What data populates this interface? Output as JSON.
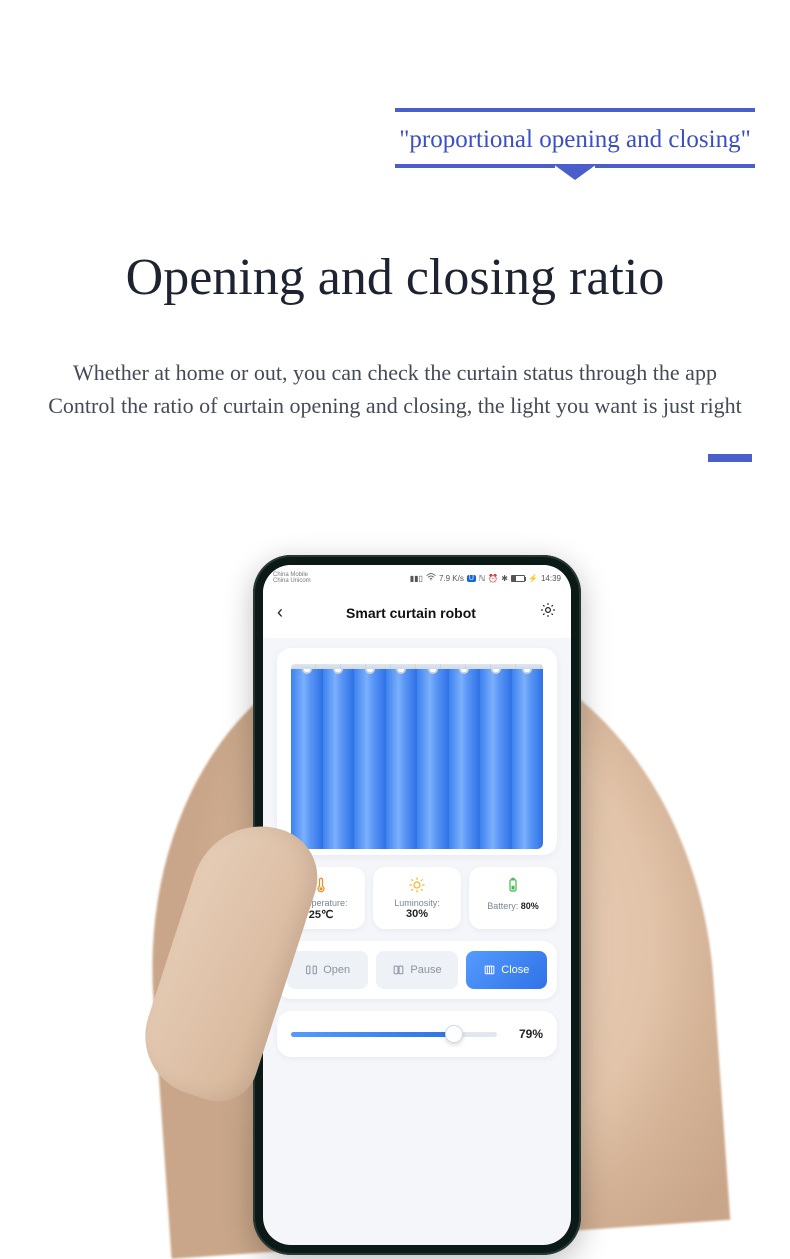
{
  "marketing": {
    "ribbon": "\"proportional opening and closing\"",
    "title": "Opening and closing ratio",
    "subtitle_line1": "Whether at home or out, you can check the curtain status through the app",
    "subtitle_line2": "Control the ratio of curtain opening and closing, the light you want is just right"
  },
  "statusbar": {
    "carrier1": "China Mobile",
    "carrier2": "China Unicom",
    "net_speed": "7.9 K/s",
    "battery_text": "33",
    "time": "14:39"
  },
  "app": {
    "title": "Smart curtain robot"
  },
  "stats": {
    "temperature": {
      "label": "Temperature:",
      "value": "25℃"
    },
    "luminosity": {
      "label": "Luminosity:",
      "value": "30%"
    },
    "battery": {
      "label": "Battery:",
      "value": "80%"
    }
  },
  "controls": {
    "open": "Open",
    "pause": "Pause",
    "close": "Close"
  },
  "slider": {
    "percent": 79,
    "percent_label": "79%"
  }
}
